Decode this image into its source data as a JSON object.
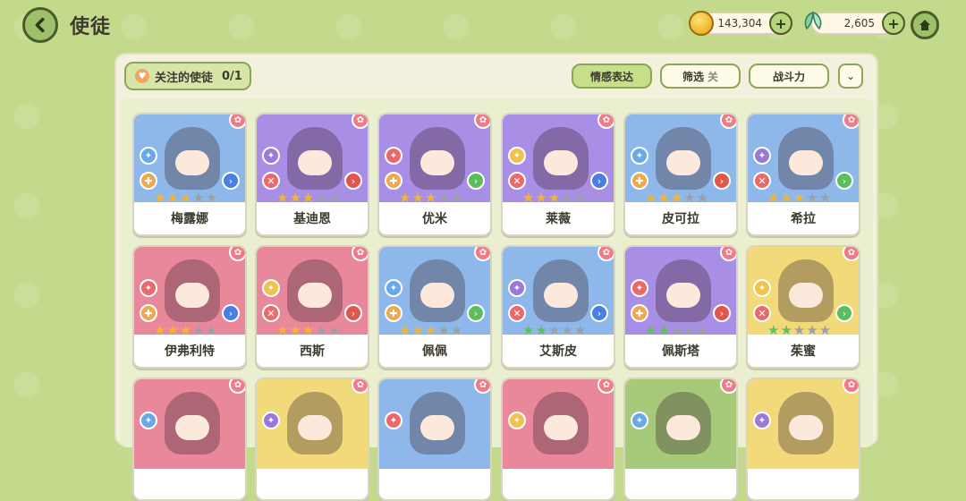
{
  "header": {
    "title": "使徒"
  },
  "currency": {
    "coins": "143,304",
    "gems": "2,605"
  },
  "toolbar": {
    "follow_label": "关注的使徒",
    "follow_count": "0/1",
    "emotion_label": "情感表达",
    "filter_label": "筛选",
    "filter_state": "关",
    "power_label": "战斗力"
  },
  "colors": {
    "blue": "#8fb8ea",
    "purple": "#a98ee6",
    "red": "#e9889b",
    "yellow": "#f2da7a",
    "green": "#a6c97a"
  },
  "cards": [
    {
      "name": "梅露娜",
      "bg": "blue",
      "stars": 3
    },
    {
      "name": "基迪恩",
      "bg": "purple",
      "stars": 3
    },
    {
      "name": "优米",
      "bg": "purple",
      "stars": 3
    },
    {
      "name": "莱薇",
      "bg": "purple",
      "stars": 3
    },
    {
      "name": "皮可拉",
      "bg": "blue",
      "stars": 3
    },
    {
      "name": "希拉",
      "bg": "blue",
      "stars": 3
    },
    {
      "name": "伊弗利特",
      "bg": "red",
      "stars": 3
    },
    {
      "name": "西斯",
      "bg": "red",
      "stars": 3
    },
    {
      "name": "佩佩",
      "bg": "blue",
      "stars": 3
    },
    {
      "name": "艾斯皮",
      "bg": "blue",
      "stars": 2
    },
    {
      "name": "佩斯塔",
      "bg": "purple",
      "stars": 2
    },
    {
      "name": "茱蜜",
      "bg": "yellow",
      "stars": 2
    },
    {
      "name": "",
      "bg": "red",
      "stars": 0
    },
    {
      "name": "",
      "bg": "yellow",
      "stars": 0
    },
    {
      "name": "",
      "bg": "blue",
      "stars": 0
    },
    {
      "name": "",
      "bg": "red",
      "stars": 0
    },
    {
      "name": "",
      "bg": "green",
      "stars": 0
    },
    {
      "name": "",
      "bg": "yellow",
      "stars": 0
    }
  ]
}
